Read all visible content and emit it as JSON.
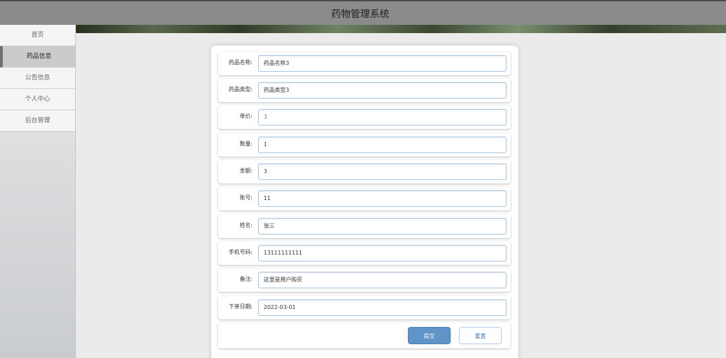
{
  "header": {
    "title": "药物管理系统"
  },
  "sidebar": {
    "items": [
      {
        "label": "首页",
        "active": false
      },
      {
        "label": "药品信息",
        "active": true
      },
      {
        "label": "公告信息",
        "active": false
      },
      {
        "label": "个人中心",
        "active": false
      },
      {
        "label": "后台管理",
        "active": false
      }
    ]
  },
  "form": {
    "fields": [
      {
        "label": "药品名称:",
        "value": "药品名称3"
      },
      {
        "label": "药品类型:",
        "value": "药品类型3"
      },
      {
        "label": "单价:",
        "value": "3"
      },
      {
        "label": "数量:",
        "value": "1"
      },
      {
        "label": "金额:",
        "value": "3"
      },
      {
        "label": "账号:",
        "value": "11"
      },
      {
        "label": "姓名:",
        "value": "张三"
      },
      {
        "label": "手机号码:",
        "value": "13111111111"
      },
      {
        "label": "备注:",
        "value": "这里是用户购买"
      },
      {
        "label": "下单日期:",
        "value": "2022-03-01"
      }
    ],
    "submit_label": "提交",
    "reset_label": "重置"
  }
}
